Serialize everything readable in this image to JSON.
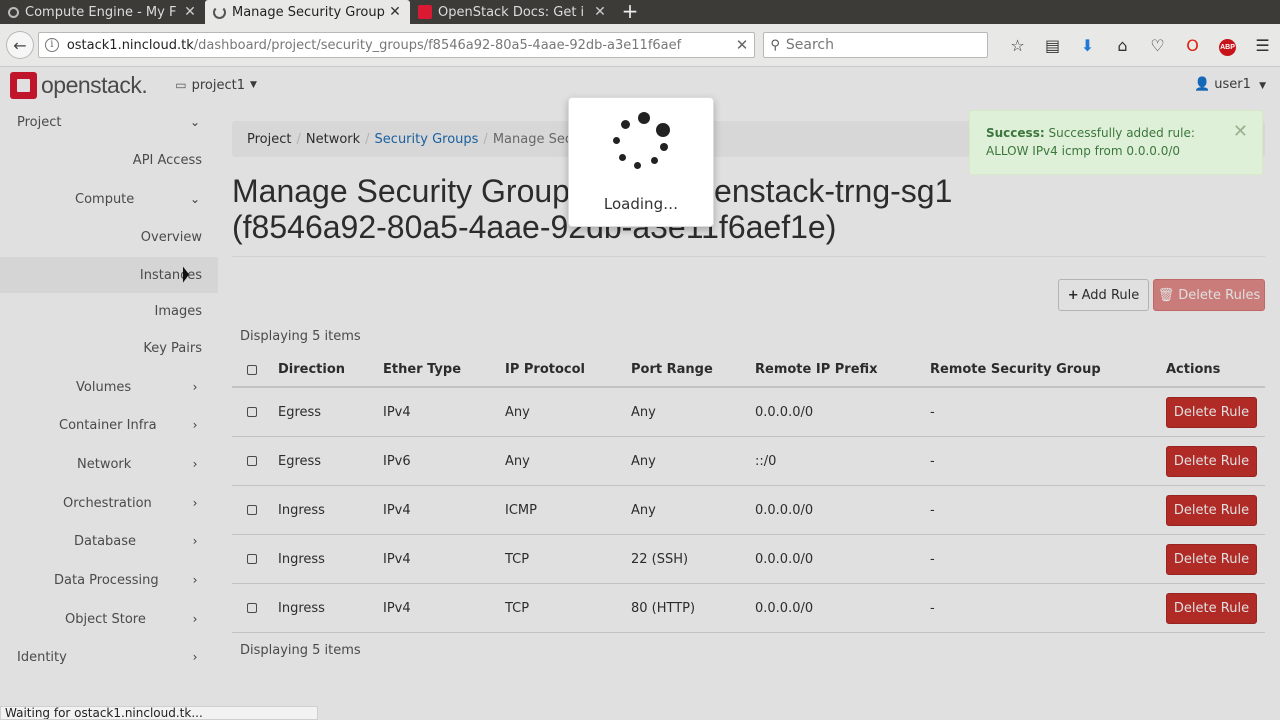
{
  "browser": {
    "tabs": [
      {
        "title": "Compute Engine - My F",
        "active": false,
        "icon": "gear-icon"
      },
      {
        "title": "Manage Security Group",
        "active": true,
        "icon": "loading-spinner-icon"
      },
      {
        "title": "OpenStack Docs: Get i",
        "active": false,
        "icon": "openstack-icon"
      }
    ],
    "url_host": "ostack1.nincloud.tk",
    "url_path": "/dashboard/project/security_groups/f8546a92-80a5-4aae-92db-a3e11f6aef",
    "search_placeholder": "Search",
    "status_text": "Waiting for ostack1.nincloud.tk..."
  },
  "header": {
    "logo_text": "openstack.",
    "project": "project1",
    "user": "user1"
  },
  "sidebar": {
    "items": [
      {
        "label": "Project",
        "chevron": "down"
      },
      {
        "label": "API Access"
      },
      {
        "label": "Compute",
        "chevron": "down"
      },
      {
        "label": "Overview"
      },
      {
        "label": "Instances"
      },
      {
        "label": "Images"
      },
      {
        "label": "Key Pairs"
      },
      {
        "label": "Volumes",
        "chevron": "right"
      },
      {
        "label": "Container Infra",
        "chevron": "right"
      },
      {
        "label": "Network",
        "chevron": "right"
      },
      {
        "label": "Orchestration",
        "chevron": "right"
      },
      {
        "label": "Database",
        "chevron": "right"
      },
      {
        "label": "Data Processing",
        "chevron": "right"
      },
      {
        "label": "Object Store",
        "chevron": "right"
      },
      {
        "label": "Identity",
        "chevron": "right"
      }
    ]
  },
  "breadcrumb": [
    "Project",
    "Network",
    "Security Groups",
    "Manage Securit"
  ],
  "page": {
    "title_line1": "Manage Security Group Rules: openstack-trng-sg1",
    "title_line2": "(f8546a92-80a5-4aae-92db-a3e11f6aef1e)",
    "add_rule": "Add Rule",
    "delete_rules": "Delete Rules",
    "count_top": "Displaying 5 items",
    "count_bottom": "Displaying 5 items"
  },
  "table": {
    "headers": [
      "Direction",
      "Ether Type",
      "IP Protocol",
      "Port Range",
      "Remote IP Prefix",
      "Remote Security Group",
      "Actions"
    ],
    "rows": [
      {
        "direction": "Egress",
        "ether": "IPv4",
        "protocol": "Any",
        "port": "Any",
        "prefix": "0.0.0.0/0",
        "group": "-",
        "action": "Delete Rule"
      },
      {
        "direction": "Egress",
        "ether": "IPv6",
        "protocol": "Any",
        "port": "Any",
        "prefix": "::/0",
        "group": "-",
        "action": "Delete Rule"
      },
      {
        "direction": "Ingress",
        "ether": "IPv4",
        "protocol": "ICMP",
        "port": "Any",
        "prefix": "0.0.0.0/0",
        "group": "-",
        "action": "Delete Rule"
      },
      {
        "direction": "Ingress",
        "ether": "IPv4",
        "protocol": "TCP",
        "port": "22 (SSH)",
        "prefix": "0.0.0.0/0",
        "group": "-",
        "action": "Delete Rule"
      },
      {
        "direction": "Ingress",
        "ether": "IPv4",
        "protocol": "TCP",
        "port": "80 (HTTP)",
        "prefix": "0.0.0.0/0",
        "group": "-",
        "action": "Delete Rule"
      }
    ]
  },
  "loading": {
    "text": "Loading…"
  },
  "alert": {
    "strong": "Success:",
    "line1": "Successfully added rule:",
    "line2": "ALLOW IPv4 icmp from 0.0.0.0/0"
  },
  "colors": {
    "brand": "#da1a32",
    "danger": "#c9302c",
    "link": "#1f6eb5",
    "success_bg": "#dff0d8"
  }
}
